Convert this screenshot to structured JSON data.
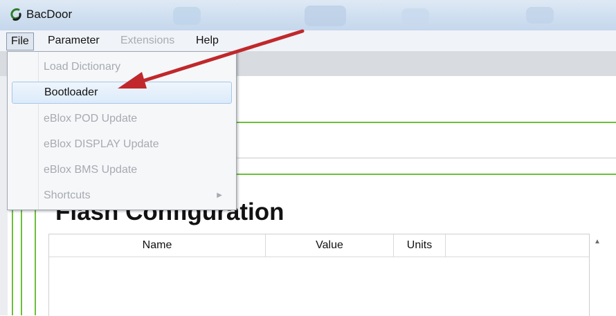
{
  "window": {
    "title": "BacDoor"
  },
  "menubar": {
    "items": [
      {
        "label": "File",
        "enabled": true,
        "active": true
      },
      {
        "label": "Parameter",
        "enabled": true
      },
      {
        "label": "Extensions",
        "enabled": false
      },
      {
        "label": "Help",
        "enabled": true
      }
    ]
  },
  "file_menu": {
    "items": [
      {
        "label": "Load Dictionary",
        "enabled": false
      },
      {
        "label": "Bootloader",
        "enabled": true,
        "highlighted": true
      },
      {
        "label": "eBlox POD Update",
        "enabled": false
      },
      {
        "label": "eBlox DISPLAY Update",
        "enabled": false
      },
      {
        "label": "eBlox BMS Update",
        "enabled": false
      },
      {
        "label": "Shortcuts",
        "enabled": false,
        "submenu_icon": "chevron-right-icon"
      }
    ]
  },
  "section": {
    "title": "Flash Configuration"
  },
  "table": {
    "columns": [
      "Name",
      "Value",
      "Units"
    ],
    "rows": []
  },
  "colors": {
    "accent_green": "#6bbf3a",
    "annotation_arrow": "#c0282b",
    "highlight": "#dcebfa"
  },
  "annotation": {
    "icon": "red-arrow-icon"
  }
}
